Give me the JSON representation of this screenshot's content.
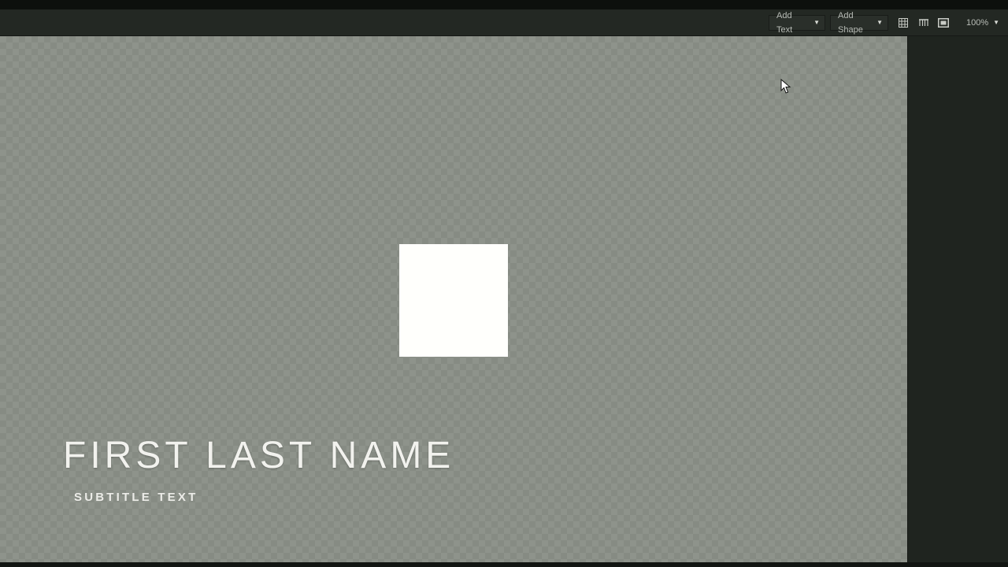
{
  "toolbar": {
    "add_text_label": "Add Text",
    "add_shape_label": "Add Shape",
    "zoom_value": "100%",
    "icons": [
      "grid-icon",
      "guides-icon",
      "safe-area-icon"
    ]
  },
  "canvas": {
    "title": "FIRST LAST NAME",
    "subtitle": "SUBTITLE TEXT",
    "shape_color": "#fffffc"
  },
  "colors": {
    "chrome": "#232823",
    "canvas": "#8e938b"
  }
}
